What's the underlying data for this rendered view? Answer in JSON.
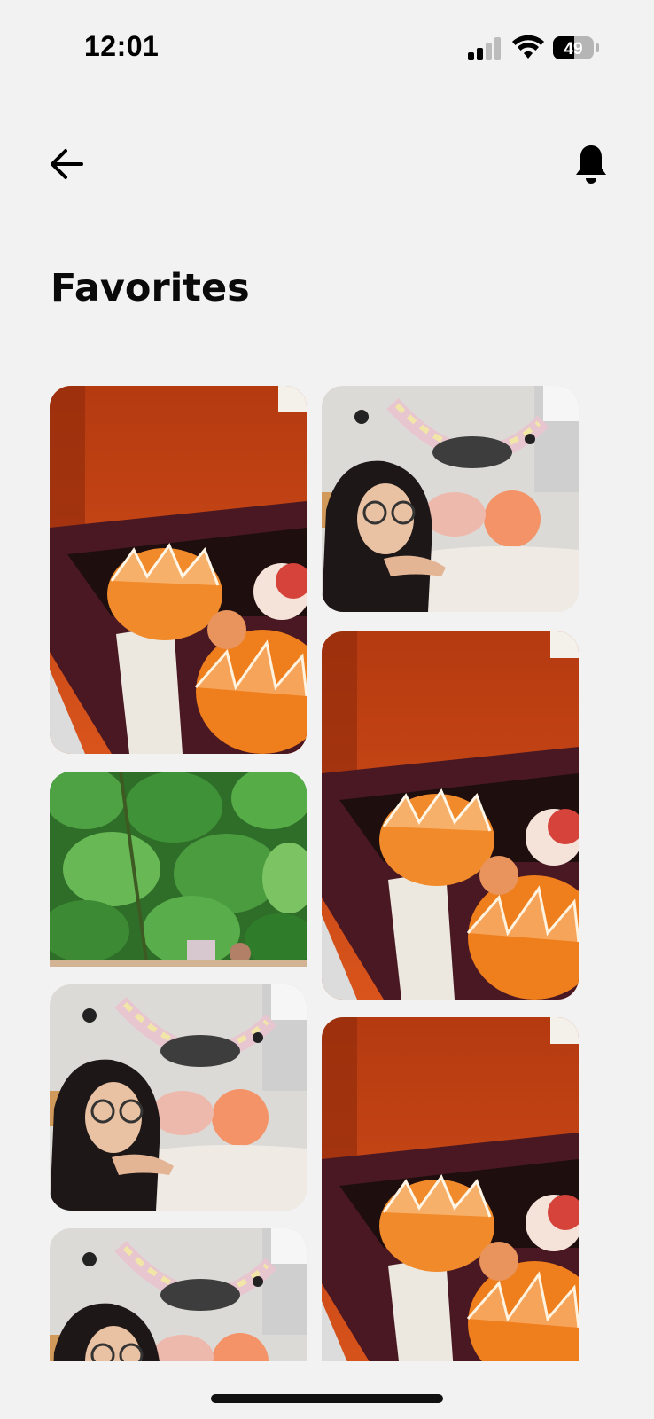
{
  "status_bar": {
    "time": "12:01",
    "battery_level": "49",
    "signal_icon": "cellular-signal-icon",
    "wifi_icon": "wifi-icon",
    "battery_icon": "battery-icon"
  },
  "header": {
    "back_icon": "arrow-left-icon",
    "notification_icon": "bell-icon"
  },
  "page": {
    "title": "Favorites"
  },
  "gallery": {
    "photos": [
      {
        "subject": "orange-dessert"
      },
      {
        "subject": "girl-with-glasses"
      },
      {
        "subject": "orange-dessert"
      },
      {
        "subject": "green-leaves"
      },
      {
        "subject": "girl-with-glasses"
      },
      {
        "subject": "orange-dessert"
      },
      {
        "subject": "girl-with-glasses"
      }
    ]
  },
  "colors": {
    "background": "#f2f2f2",
    "text": "#0a0a0a"
  }
}
